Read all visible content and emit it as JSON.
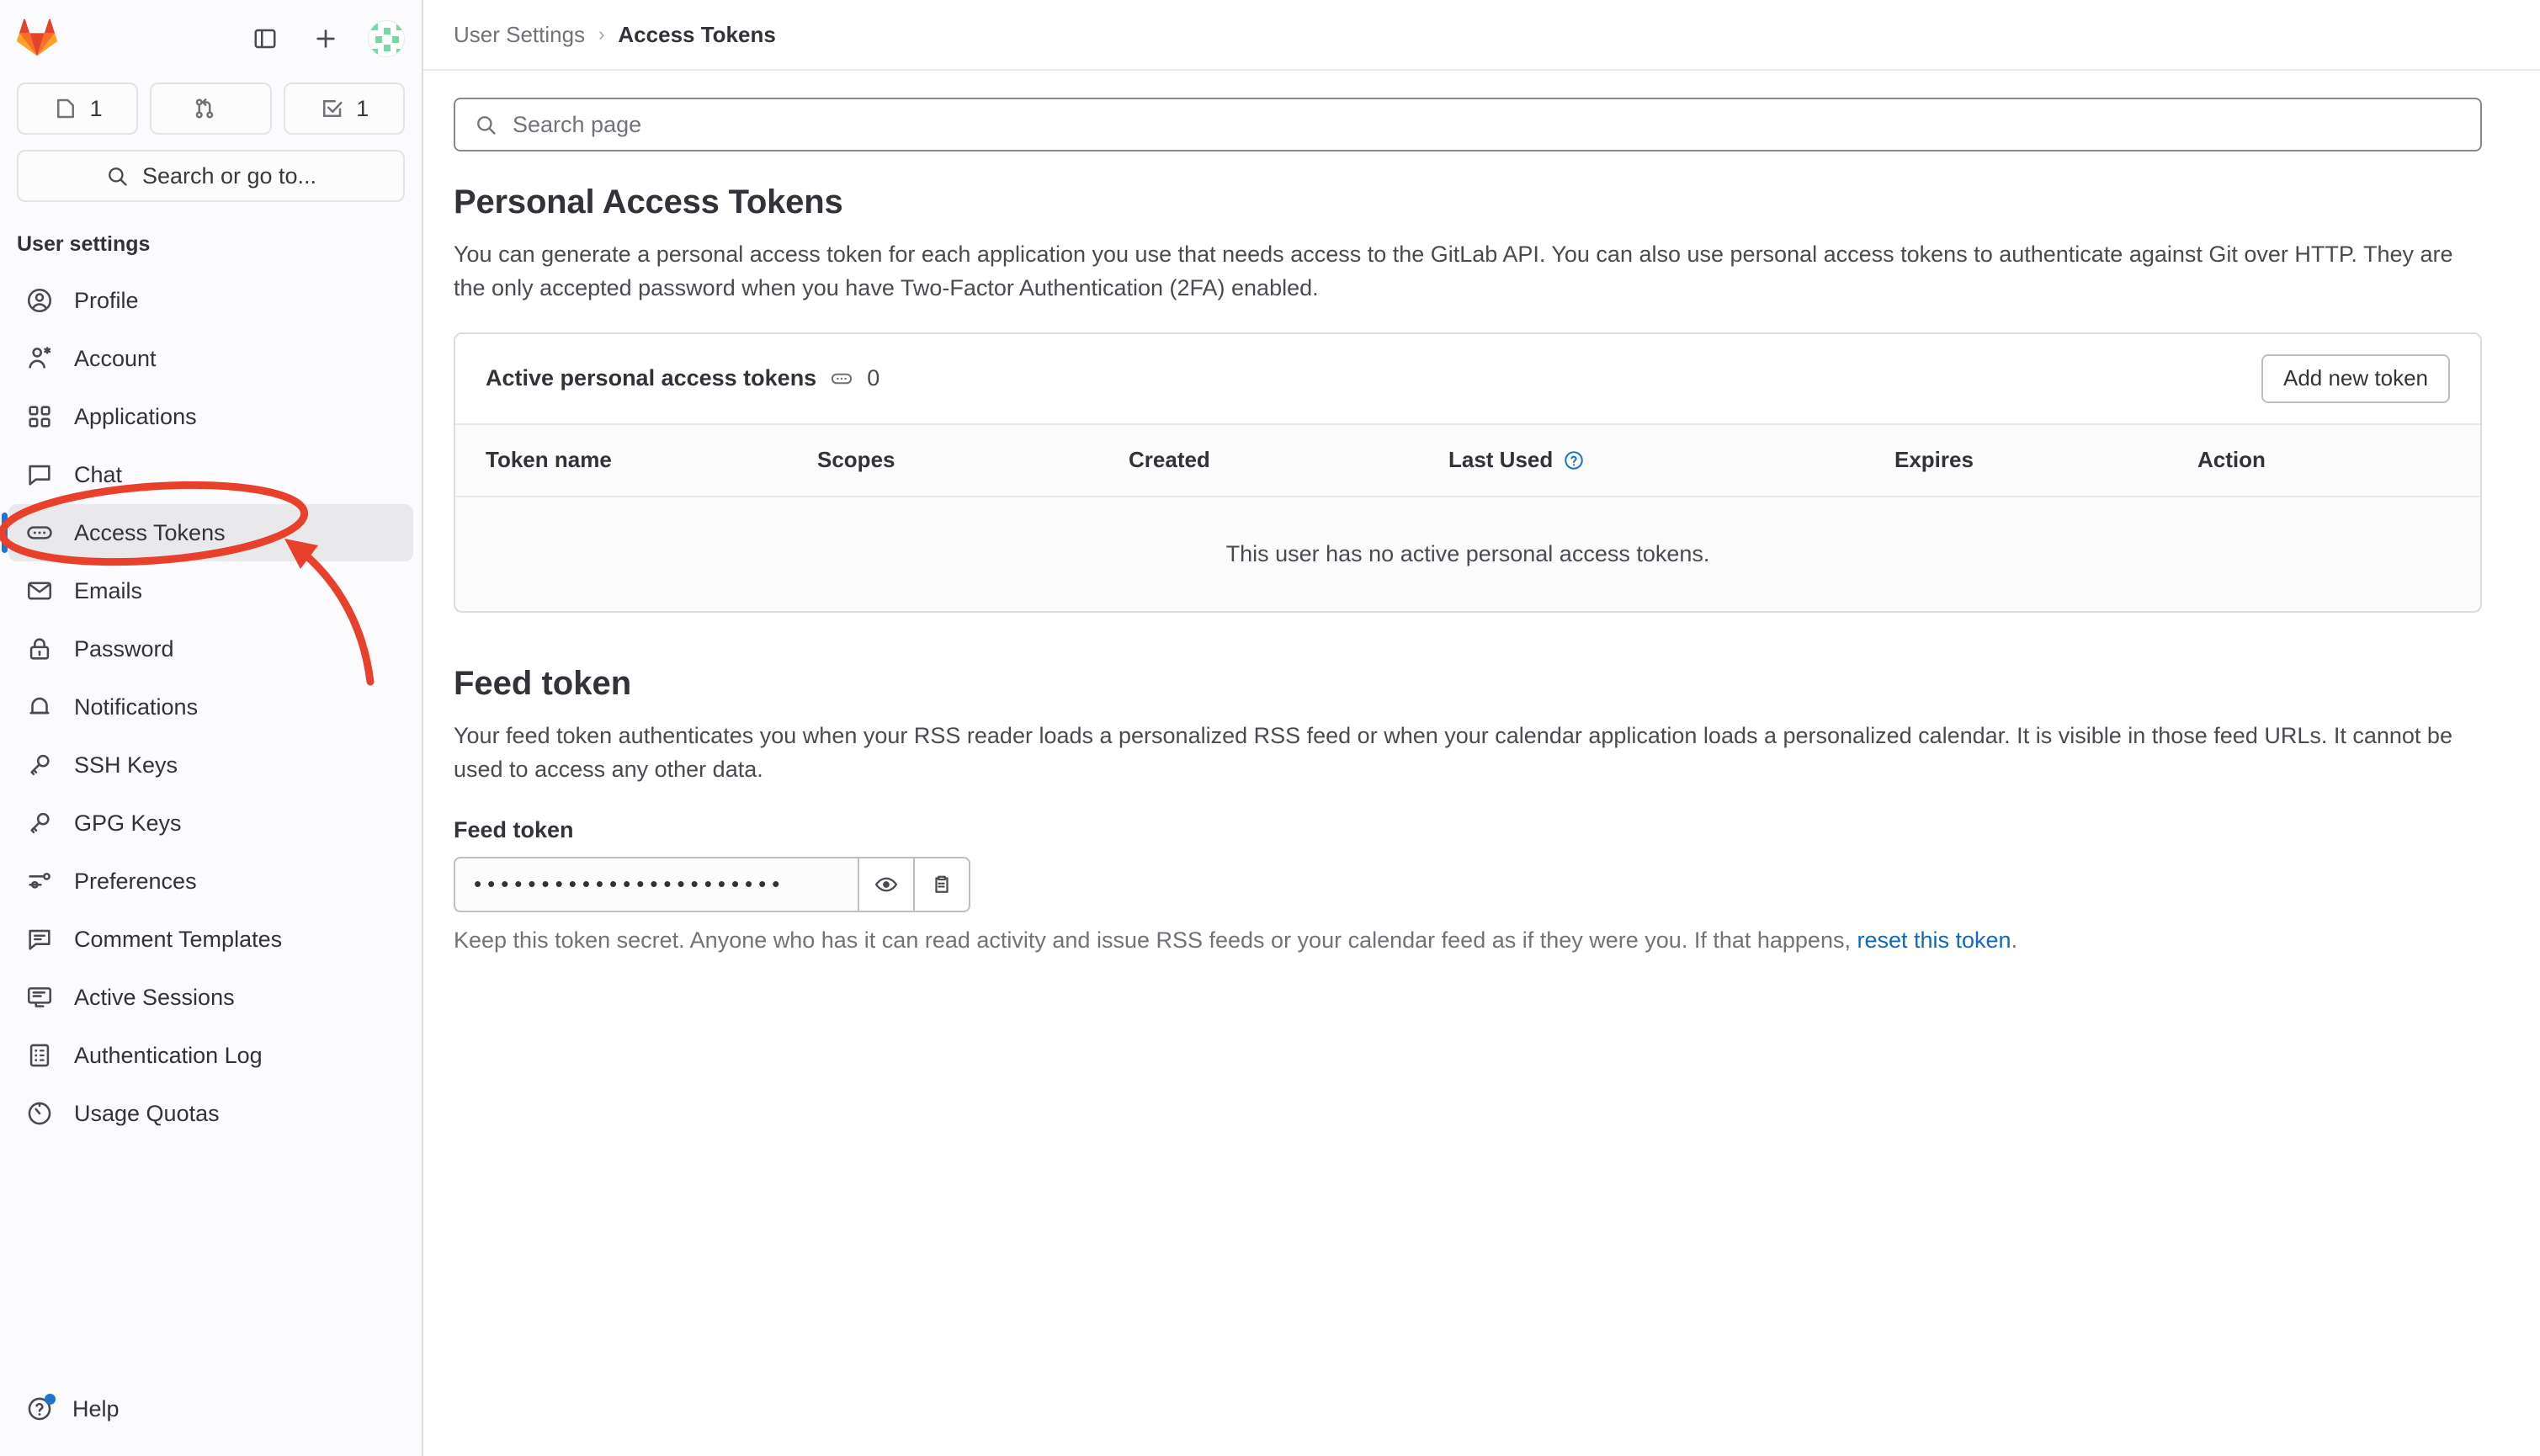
{
  "sidebar": {
    "logo_icon": "gitlab-tanuki-logo",
    "toggle_icon": "sidebar-toggle-icon",
    "new_icon": "plus-icon",
    "avatar_icon": "user-avatar",
    "counters": [
      {
        "icon": "issues-icon",
        "value": "1",
        "name": "issues-counter"
      },
      {
        "icon": "merge-requests-icon",
        "value": "",
        "name": "merge-requests-counter"
      },
      {
        "icon": "todos-icon",
        "value": "1",
        "name": "todos-counter"
      }
    ],
    "search_label": "Search or go to...",
    "search_icon": "search-icon",
    "section_title": "User settings",
    "items": [
      {
        "label": "Profile",
        "icon": "profile-icon",
        "active": false
      },
      {
        "label": "Account",
        "icon": "account-icon",
        "active": false
      },
      {
        "label": "Applications",
        "icon": "applications-icon",
        "active": false
      },
      {
        "label": "Chat",
        "icon": "chat-icon",
        "active": false
      },
      {
        "label": "Access Tokens",
        "icon": "token-icon",
        "active": true
      },
      {
        "label": "Emails",
        "icon": "email-icon",
        "active": false
      },
      {
        "label": "Password",
        "icon": "lock-icon",
        "active": false
      },
      {
        "label": "Notifications",
        "icon": "bell-icon",
        "active": false
      },
      {
        "label": "SSH Keys",
        "icon": "key-icon",
        "active": false
      },
      {
        "label": "GPG Keys",
        "icon": "key-icon",
        "active": false
      },
      {
        "label": "Preferences",
        "icon": "preferences-icon",
        "active": false
      },
      {
        "label": "Comment Templates",
        "icon": "comment-icon",
        "active": false
      },
      {
        "label": "Active Sessions",
        "icon": "monitor-icon",
        "active": false
      },
      {
        "label": "Authentication Log",
        "icon": "log-icon",
        "active": false
      },
      {
        "label": "Usage Quotas",
        "icon": "quota-icon",
        "active": false
      }
    ],
    "help_label": "Help",
    "help_icon": "question-circle-icon"
  },
  "breadcrumb": {
    "parent": "User Settings",
    "separator": "›",
    "current": "Access Tokens"
  },
  "search": {
    "placeholder": "Search page",
    "value": "",
    "icon": "search-icon"
  },
  "pat": {
    "heading": "Personal Access Tokens",
    "description": "You can generate a personal access token for each application you use that needs access to the GitLab API. You can also use personal access tokens to authenticate against Git over HTTP. They are the only accepted password when you have Two-Factor Authentication (2FA) enabled.",
    "card_title": "Active personal access tokens",
    "card_title_icon": "token-icon",
    "count": "0",
    "add_button": "Add new token",
    "columns": [
      {
        "label": "Token name",
        "help_icon": false
      },
      {
        "label": "Scopes",
        "help_icon": false
      },
      {
        "label": "Created",
        "help_icon": false
      },
      {
        "label": "Last Used",
        "help_icon": true
      },
      {
        "label": "Expires",
        "help_icon": false
      },
      {
        "label": "Action",
        "help_icon": false
      }
    ],
    "empty_message": "This user has no active personal access tokens."
  },
  "feed": {
    "heading": "Feed token",
    "description": "Your feed token authenticates you when your RSS reader loads a personalized RSS feed or when your calendar application loads a personalized calendar. It is visible in those feed URLs. It cannot be used to access any other data.",
    "field_label": "Feed token",
    "masked_value": "•••••••••••••••••••••••",
    "reveal_icon": "eye-icon",
    "copy_icon": "clipboard-icon",
    "helper_prefix": "Keep this token secret. Anyone who has it can read activity and issue RSS feeds or your calendar feed as if they were you. If that happens, ",
    "helper_link": "reset this token",
    "helper_suffix": "."
  },
  "annotation": {
    "shape": "red-ellipse-with-arrow",
    "target": "Access Tokens",
    "color": "#e8402a"
  },
  "colors": {
    "accent_blue": "#1f75cb",
    "link_blue": "#1068bf",
    "annotation_red": "#e8402a",
    "sidebar_bg": "#fbfafd",
    "active_item_bg": "#e9e9ec"
  }
}
